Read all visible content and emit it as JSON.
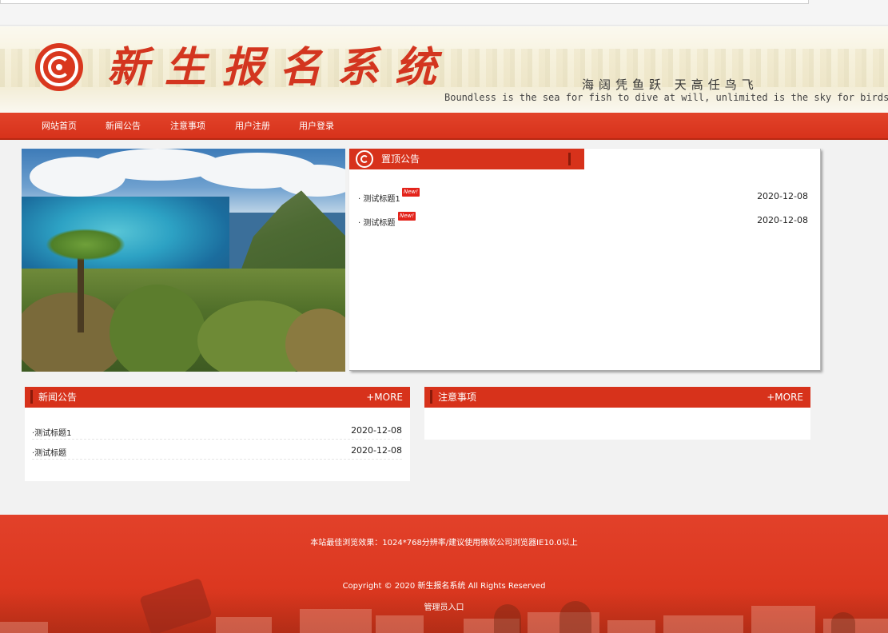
{
  "header": {
    "site_title": "新生报名系统",
    "slogan_cn": "海阔凭鱼跃   天高任鸟飞",
    "slogan_en": "Boundless is the sea for fish to dive at will, unlimited is the sky for birds to fly"
  },
  "nav": {
    "items": [
      {
        "label": "网站首页"
      },
      {
        "label": "新闻公告"
      },
      {
        "label": "注意事项"
      },
      {
        "label": "用户注册"
      },
      {
        "label": "用户登录"
      }
    ]
  },
  "pinned": {
    "title": "置顶公告",
    "new_badge": "New!",
    "items": [
      {
        "title": "· 测试标题1",
        "date": "2020-12-08"
      },
      {
        "title": "· 测试标题",
        "date": "2020-12-08"
      }
    ]
  },
  "news": {
    "title": "新闻公告",
    "more": "+MORE",
    "items": [
      {
        "title": "·测试标题1",
        "date": "2020-12-08"
      },
      {
        "title": "·测试标题",
        "date": "2020-12-08"
      }
    ]
  },
  "notice": {
    "title": "注意事项",
    "more": "+MORE"
  },
  "footer": {
    "browser_tip": "本站最佳浏览效果：1024*768分辨率/建议使用微软公司浏览器IE10.0以上",
    "copyright": "Copyright © 2020 新生报名系统 All Rights Reserved",
    "admin_link": "管理员入口"
  },
  "colors": {
    "accent": "#d7321b",
    "accent_dark": "#8a1a0a",
    "badge_red": "#e3231b",
    "background": "#f2f2f2"
  }
}
